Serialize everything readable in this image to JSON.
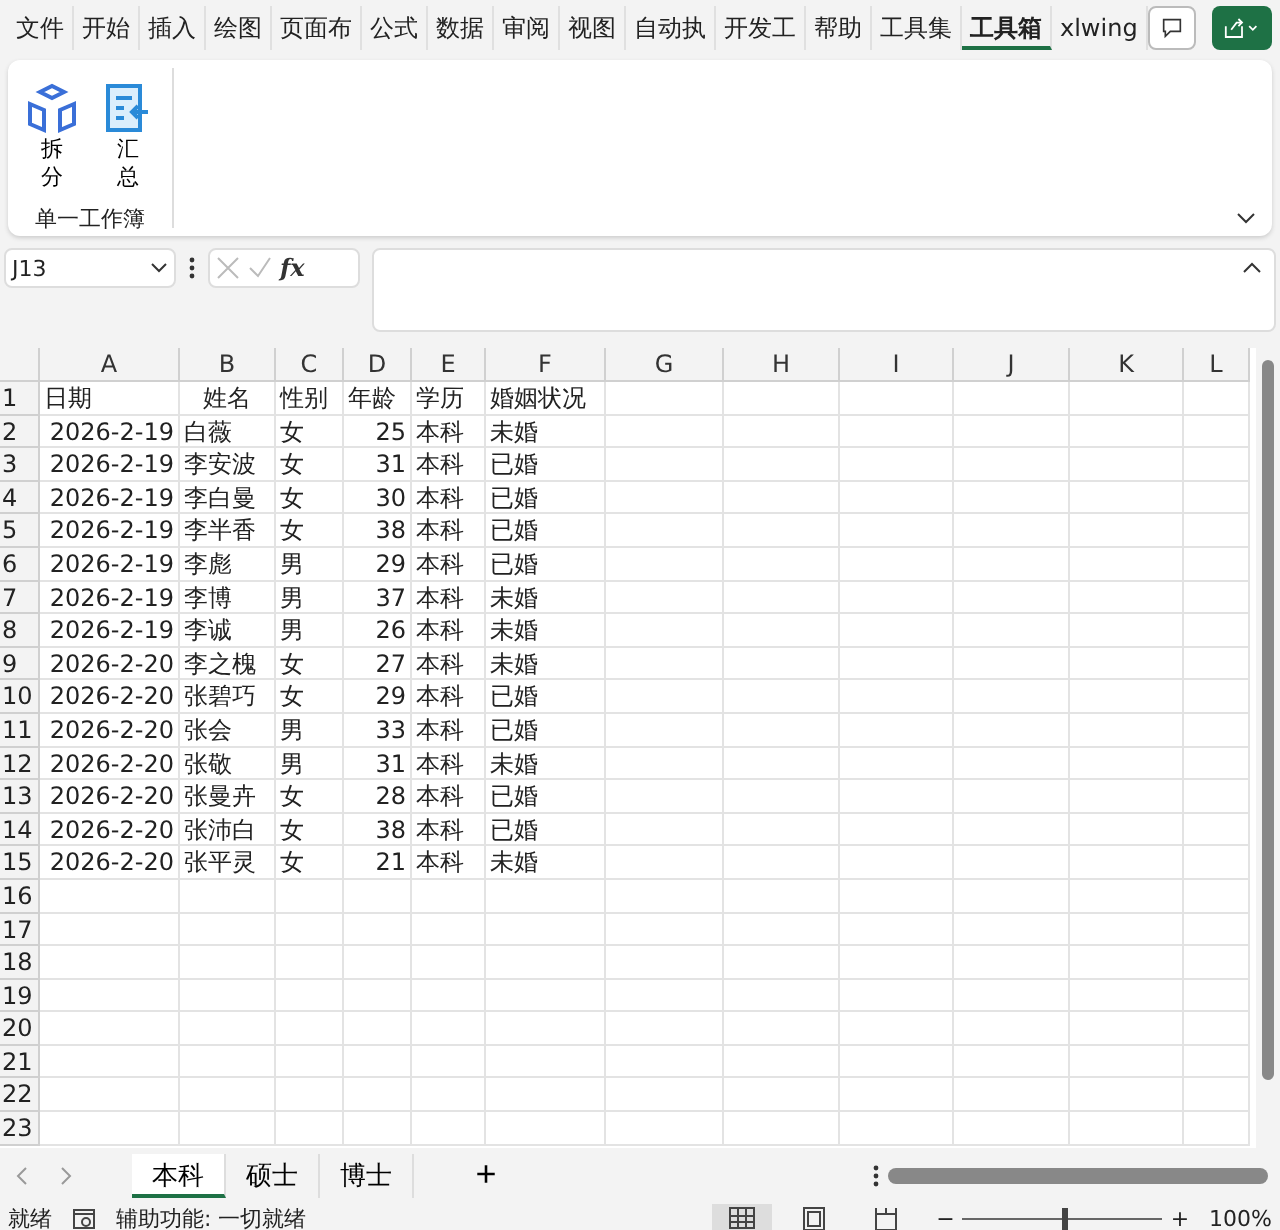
{
  "ribbon_tabs": [
    {
      "label": "文件",
      "selected": false
    },
    {
      "label": "开始",
      "selected": false
    },
    {
      "label": "插入",
      "selected": false
    },
    {
      "label": "绘图",
      "selected": false
    },
    {
      "label": "页面布",
      "selected": false
    },
    {
      "label": "公式",
      "selected": false
    },
    {
      "label": "数据",
      "selected": false
    },
    {
      "label": "审阅",
      "selected": false
    },
    {
      "label": "视图",
      "selected": false
    },
    {
      "label": "自动执",
      "selected": false
    },
    {
      "label": "开发工",
      "selected": false
    },
    {
      "label": "帮助",
      "selected": false
    },
    {
      "label": "工具集",
      "selected": false
    },
    {
      "label": "工具箱",
      "selected": true
    },
    {
      "label": "xlwing",
      "selected": false
    }
  ],
  "ribbon": {
    "buttons": [
      {
        "kind": "split",
        "label": "拆分"
      },
      {
        "kind": "merge",
        "label": "汇总"
      }
    ],
    "group_label": "单一工作簿"
  },
  "formula_bar": {
    "name_box": "J13",
    "fx": "fx"
  },
  "columns": [
    {
      "label": "A"
    },
    {
      "label": "B"
    },
    {
      "label": "C"
    },
    {
      "label": "D"
    },
    {
      "label": "E"
    },
    {
      "label": "F"
    },
    {
      "label": "G"
    },
    {
      "label": "H"
    },
    {
      "label": "I"
    },
    {
      "label": "J"
    },
    {
      "label": "K"
    },
    {
      "label": "L"
    }
  ],
  "rows": [
    {
      "number": "1",
      "kind": "header",
      "cells": [
        "日期",
        "姓名",
        "性别",
        "年龄",
        "学历",
        "婚姻状况"
      ]
    },
    {
      "number": "2",
      "cells": [
        "2026-2-19",
        "白薇",
        "女",
        "25",
        "本科",
        "未婚"
      ]
    },
    {
      "number": "3",
      "cells": [
        "2026-2-19",
        "李安波",
        "女",
        "31",
        "本科",
        "已婚"
      ]
    },
    {
      "number": "4",
      "cells": [
        "2026-2-19",
        "李白曼",
        "女",
        "30",
        "本科",
        "已婚"
      ]
    },
    {
      "number": "5",
      "cells": [
        "2026-2-19",
        "李半香",
        "女",
        "38",
        "本科",
        "已婚"
      ]
    },
    {
      "number": "6",
      "cells": [
        "2026-2-19",
        "李彪",
        "男",
        "29",
        "本科",
        "已婚"
      ]
    },
    {
      "number": "7",
      "cells": [
        "2026-2-19",
        "李博",
        "男",
        "37",
        "本科",
        "未婚"
      ]
    },
    {
      "number": "8",
      "cells": [
        "2026-2-19",
        "李诚",
        "男",
        "26",
        "本科",
        "未婚"
      ]
    },
    {
      "number": "9",
      "cells": [
        "2026-2-20",
        "李之槐",
        "女",
        "27",
        "本科",
        "未婚"
      ]
    },
    {
      "number": "10",
      "cells": [
        "2026-2-20",
        "张碧巧",
        "女",
        "29",
        "本科",
        "已婚"
      ]
    },
    {
      "number": "11",
      "cells": [
        "2026-2-20",
        "张会",
        "男",
        "33",
        "本科",
        "已婚"
      ]
    },
    {
      "number": "12",
      "cells": [
        "2026-2-20",
        "张敬",
        "男",
        "31",
        "本科",
        "未婚"
      ]
    },
    {
      "number": "13",
      "cells": [
        "2026-2-20",
        "张曼卉",
        "女",
        "28",
        "本科",
        "已婚"
      ]
    },
    {
      "number": "14",
      "cells": [
        "2026-2-20",
        "张沛白",
        "女",
        "38",
        "本科",
        "已婚"
      ]
    },
    {
      "number": "15",
      "cells": [
        "2026-2-20",
        "张平灵",
        "女",
        "21",
        "本科",
        "未婚"
      ]
    },
    {
      "number": "16"
    },
    {
      "number": "17"
    },
    {
      "number": "18"
    },
    {
      "number": "19"
    },
    {
      "number": "20"
    },
    {
      "number": "21"
    },
    {
      "number": "22"
    },
    {
      "number": "23"
    }
  ],
  "sheet_tabs": [
    {
      "label": "本科",
      "selected": true
    },
    {
      "label": "硕士",
      "selected": false
    },
    {
      "label": "博士",
      "selected": false
    }
  ],
  "add_sheet": "+",
  "status_bar": {
    "ready": "就绪",
    "accessibility": "辅助功能: 一切就绪",
    "views": [
      {
        "kind": "normal",
        "selected": true
      },
      {
        "kind": "layout",
        "selected": false
      },
      {
        "kind": "pagebreak",
        "selected": false
      }
    ],
    "zoom_minus": "−",
    "zoom_plus": "+",
    "zoom": "100%",
    "level": 0.5
  }
}
